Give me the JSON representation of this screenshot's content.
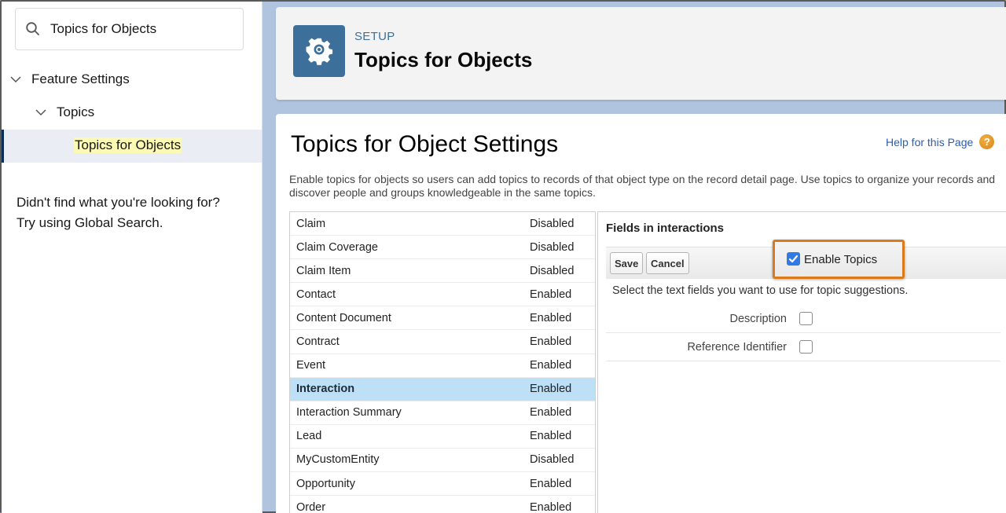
{
  "sidebar": {
    "search": {
      "value": "Topics for Objects",
      "icon": "search-icon"
    },
    "tree": [
      {
        "label": "Feature Settings",
        "expanded": true,
        "icon": "chevron-down-icon"
      },
      {
        "label": "Topics",
        "expanded": true,
        "icon": "chevron-down-icon"
      },
      {
        "label": "Topics for Objects",
        "selected": true
      }
    ],
    "not_found_line1": "Didn't find what you're looking for?",
    "not_found_line2": "Try using Global Search."
  },
  "header": {
    "icon": "gear-icon",
    "eyebrow": "SETUP",
    "title": "Topics for Objects"
  },
  "main": {
    "title": "Topics for Object Settings",
    "help_link": "Help for this Page",
    "help_icon": "question-icon",
    "description": "Enable topics for objects so users can add topics to records of that object type on the record detail page. Use topics to organize your records and discover people and groups knowledgeable in the same topics.",
    "objects": [
      {
        "name": "Claim",
        "status": "Disabled"
      },
      {
        "name": "Claim Coverage",
        "status": "Disabled"
      },
      {
        "name": "Claim Item",
        "status": "Disabled"
      },
      {
        "name": "Contact",
        "status": "Enabled"
      },
      {
        "name": "Content Document",
        "status": "Enabled"
      },
      {
        "name": "Contract",
        "status": "Enabled"
      },
      {
        "name": "Event",
        "status": "Enabled"
      },
      {
        "name": "Interaction",
        "status": "Enabled",
        "selected": true
      },
      {
        "name": "Interaction Summary",
        "status": "Enabled"
      },
      {
        "name": "Lead",
        "status": "Enabled"
      },
      {
        "name": "MyCustomEntity",
        "status": "Disabled"
      },
      {
        "name": "Opportunity",
        "status": "Enabled"
      },
      {
        "name": "Order",
        "status": "Enabled"
      }
    ],
    "fields_panel": {
      "title": "Fields in interactions",
      "save_label": "Save",
      "cancel_label": "Cancel",
      "enable_topics_label": "Enable Topics",
      "enable_topics_checked": true,
      "highlight_color": "#d97a1c",
      "instruction": "Select the text fields you want to use for topic suggestions.",
      "fields": [
        {
          "label": "Description",
          "checked": false
        },
        {
          "label": "Reference Identifier",
          "checked": false
        }
      ]
    }
  }
}
